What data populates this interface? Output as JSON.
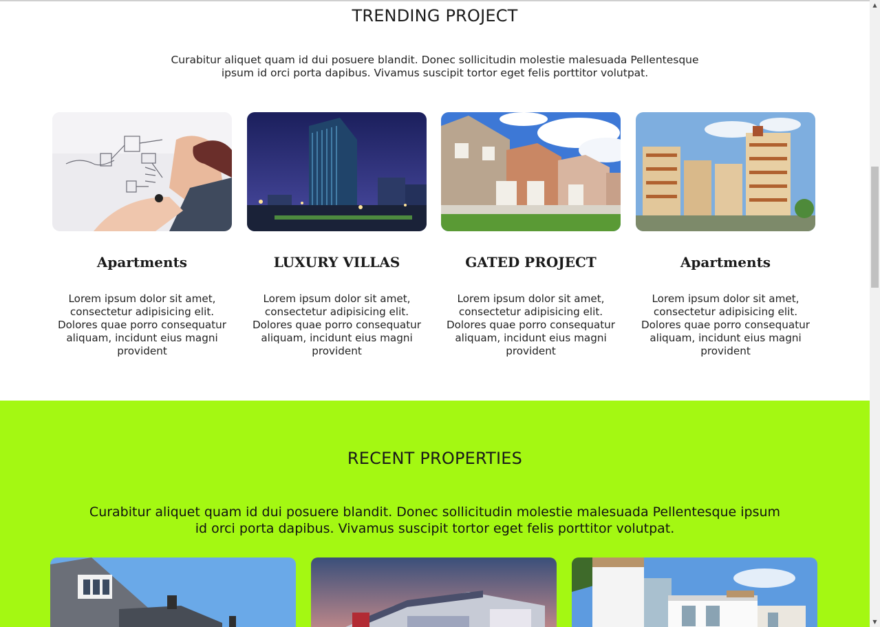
{
  "trending": {
    "title": "TRENDING PROJECT",
    "description": "Curabitur aliquet quam id dui posuere blandit. Donec sollicitudin molestie malesuada Pellentesque ipsum id orci porta dapibus. Vivamus suscipit tortor eget felis porttitor volutpat.",
    "cards": [
      {
        "title": "Apartments",
        "text": "Lorem ipsum dolor sit amet, consectetur adipisicing elit. Dolores quae porro consequatur aliquam, incidunt eius magni provident",
        "image": "whiteboard-photo"
      },
      {
        "title": "LUXURY VILLAS",
        "text": "Lorem ipsum dolor sit amet, consectetur adipisicing elit. Dolores quae porro consequatur aliquam, incidunt eius magni provident",
        "image": "night-tower-photo"
      },
      {
        "title": "GATED PROJECT",
        "text": "Lorem ipsum dolor sit amet, consectetur adipisicing elit. Dolores quae porro consequatur aliquam, incidunt eius magni provident",
        "image": "townhouses-photo"
      },
      {
        "title": "Apartments",
        "text": "Lorem ipsum dolor sit amet, consectetur adipisicing elit. Dolores quae porro consequatur aliquam, incidunt eius magni provident",
        "image": "apartment-block-photo"
      }
    ]
  },
  "recent": {
    "title": "RECENT PROPERTIES",
    "description": "Curabitur aliquet quam id dui posuere blandit. Donec sollicitudin molestie malesuada Pellentesque ipsum id orci porta dapibus. Vivamus suscipit tortor eget felis porttitor volutpat.",
    "properties": [
      {
        "image": "brick-house-photo"
      },
      {
        "image": "modern-house-dusk-photo"
      },
      {
        "image": "white-villa-photo"
      }
    ]
  },
  "colors": {
    "recent_background": "#a4f812",
    "text": "#1a1a1a",
    "scrollbar_track": "#f1f1f1",
    "scrollbar_thumb": "#c1c1c1"
  }
}
